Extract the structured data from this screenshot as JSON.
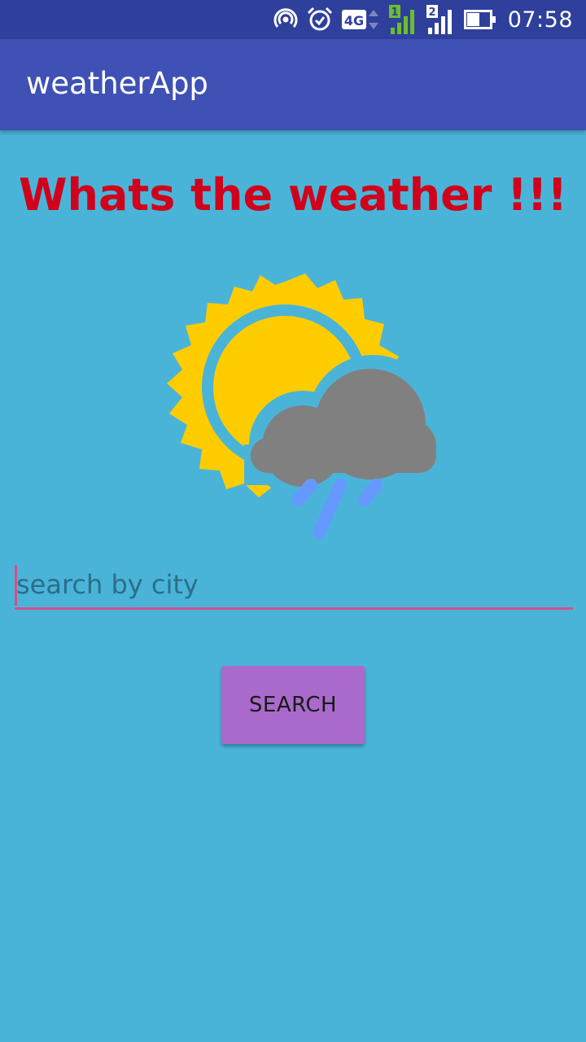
{
  "status_bar": {
    "time": "07:58",
    "network_label": "4G",
    "sim1_label": "1",
    "sim2_label": "2",
    "icons": [
      "hotspot-icon",
      "alarm-icon",
      "network-4g-icon",
      "signal-sim1-icon",
      "signal-sim2-icon",
      "battery-icon"
    ]
  },
  "app_bar": {
    "title": "weatherApp"
  },
  "main": {
    "headline": "Whats the weather !!!",
    "illustration": "weather-sun-cloud-rain-icon",
    "search": {
      "value": "",
      "placeholder": "search by city"
    },
    "search_button_label": "SEARCH"
  },
  "colors": {
    "status_bar": "#2f3f9c",
    "app_bar": "#3f51b5",
    "background": "#4ab4d8",
    "headline": "#d0021b",
    "accent": "#d4508a",
    "button": "#a96acb",
    "sun": "#ffcc00",
    "cloud": "#808080",
    "rain": "#6699ff"
  }
}
